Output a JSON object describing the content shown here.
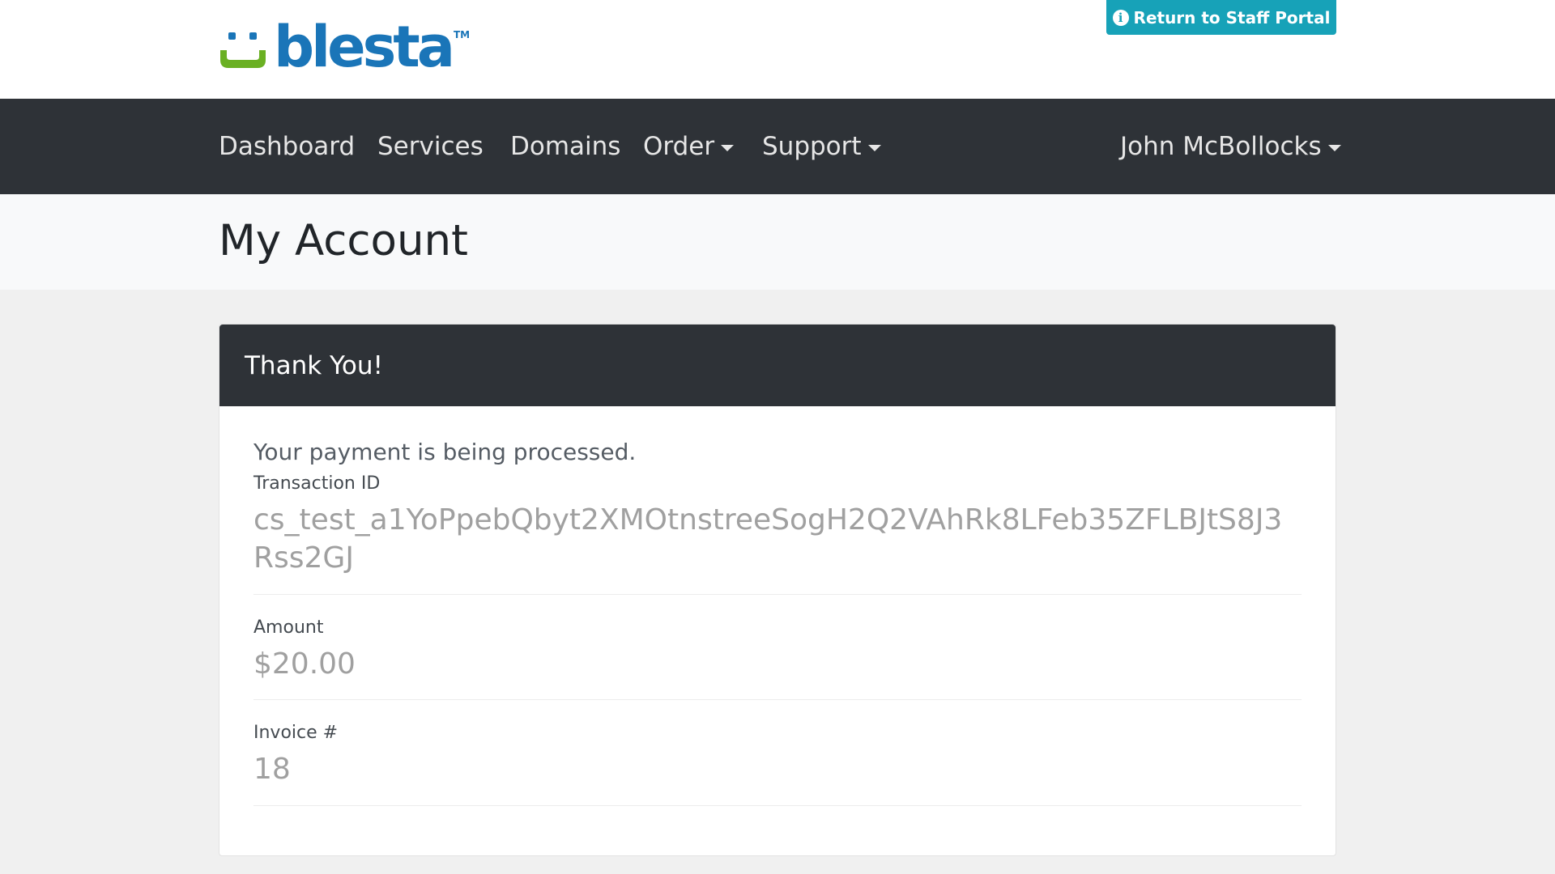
{
  "brand": {
    "name": "blesta",
    "tm": "TM"
  },
  "header": {
    "staff_portal_label": "Return to Staff Portal"
  },
  "nav": {
    "dashboard": "Dashboard",
    "services": "Services",
    "domains": "Domains",
    "order": "Order",
    "support": "Support",
    "user": "John McBollocks"
  },
  "page": {
    "title": "My Account"
  },
  "card": {
    "header": "Thank You!",
    "message": "Your payment is being processed.",
    "transaction_label": "Transaction ID",
    "transaction_value": "cs_test_a1YoPpebQbyt2XMOtnstreeSogH2Q2VAhRk8LFeb35ZFLBJtS8J3Rss2GJ",
    "amount_label": "Amount",
    "amount_value": "$20.00",
    "invoice_label": "Invoice #",
    "invoice_value": "18"
  },
  "colors": {
    "brand_blue": "#1a75b8",
    "brand_green": "#6ab023",
    "accent_teal": "#17a2b8",
    "navbar": "#2e3237"
  },
  "icons": {
    "staff_portal": "info-circle-icon",
    "dropdown": "caret-down-icon"
  }
}
